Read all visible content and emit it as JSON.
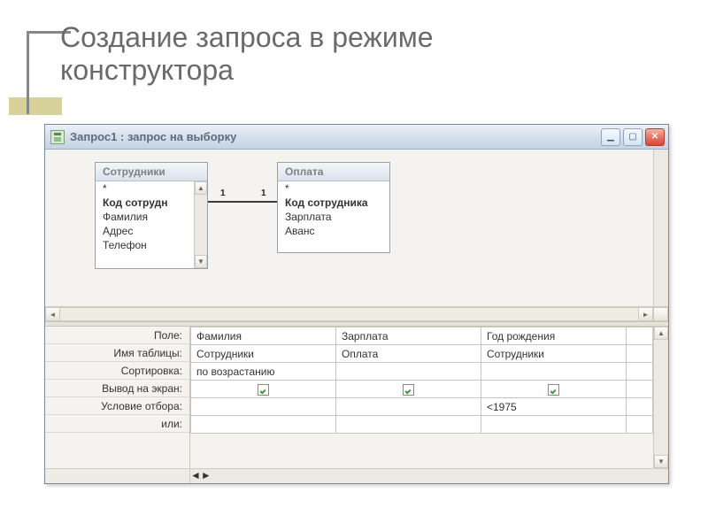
{
  "slide": {
    "title_line1": "Создание запроса в режиме",
    "title_line2": "конструктора"
  },
  "window": {
    "title": "Запрос1 : запрос на выборку"
  },
  "tables": [
    {
      "name": "Сотрудники",
      "fields": [
        "*",
        "Код сотрудн",
        "Фамилия",
        "Адрес",
        "Телефон"
      ],
      "bold_fields": [
        1
      ],
      "has_scroll": true
    },
    {
      "name": "Оплата",
      "fields": [
        "*",
        "Код сотрудника",
        "Зарплата",
        "Аванс"
      ],
      "bold_fields": [
        1
      ],
      "has_scroll": false
    }
  ],
  "relation": {
    "left_card": "1",
    "right_card": "1"
  },
  "design_rows": {
    "labels": [
      "Поле:",
      "Имя таблицы:",
      "Сортировка:",
      "Вывод на экран:",
      "Условие отбора:",
      "или:"
    ],
    "columns": [
      {
        "field": "Фамилия",
        "table": "Сотрудники",
        "sort": "по возрастанию",
        "show": true,
        "criteria": "",
        "or": ""
      },
      {
        "field": "Зарплата",
        "table": "Оплата",
        "sort": "",
        "show": true,
        "criteria": "",
        "or": ""
      },
      {
        "field": "Год рождения",
        "table": "Сотрудники",
        "sort": "",
        "show": true,
        "criteria": "<1975",
        "or": ""
      }
    ]
  }
}
